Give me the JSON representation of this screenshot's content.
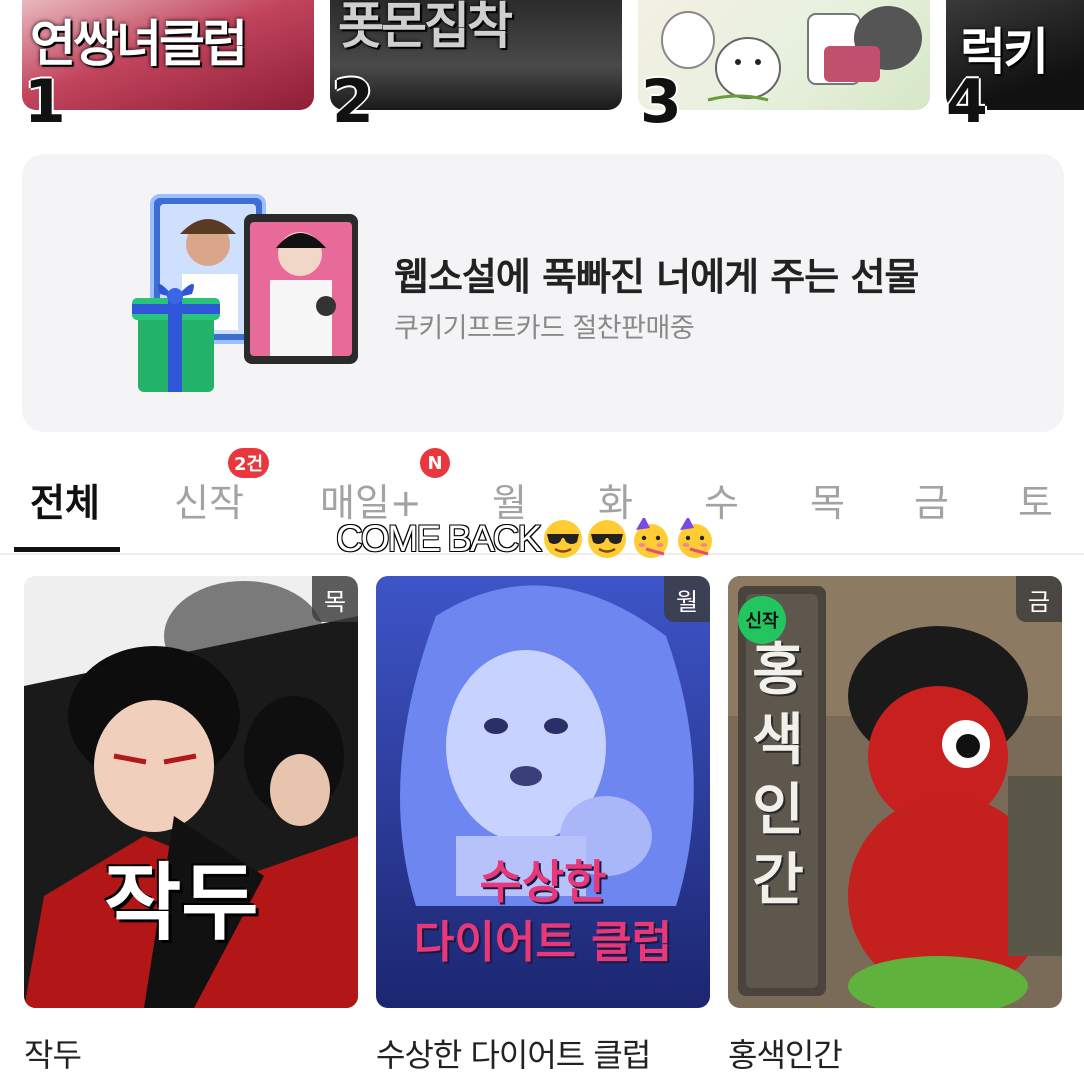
{
  "rankings": [
    {
      "rank": "1",
      "cover_text": "연쌍녀클럽"
    },
    {
      "rank": "2",
      "cover_text": "폿몬집착"
    },
    {
      "rank": "3",
      "cover_text": ""
    },
    {
      "rank": "4",
      "cover_text": "럭키"
    }
  ],
  "promo": {
    "title": "웹소설에 푹빠진 너에게 주는 선물",
    "subtitle": "쿠키기프트카드 절찬판매중",
    "icon": "gift-box-icon"
  },
  "tabs": [
    {
      "label": "전체",
      "active": true
    },
    {
      "label": "신작",
      "badge": "2건"
    },
    {
      "label": "매일+",
      "badge": "N"
    },
    {
      "label": "월"
    },
    {
      "label": "화"
    },
    {
      "label": "수"
    },
    {
      "label": "목"
    },
    {
      "label": "금"
    },
    {
      "label": "토"
    }
  ],
  "overlay": {
    "text": "COME BACK",
    "emojis": [
      "sunglasses-face",
      "sunglasses-face",
      "partying-face",
      "partying-face"
    ]
  },
  "cards": [
    {
      "title": "작두",
      "day": "목",
      "cover_text": "작두",
      "is_new": false
    },
    {
      "title": "수상한 다이어트 클럽",
      "day": "월",
      "cover_text_line1": "수상한",
      "cover_text_line2": "다이어트 클럽",
      "is_new": false
    },
    {
      "title": "홍색인간",
      "day": "금",
      "cover_text": "홍색인간",
      "is_new": true,
      "new_label": "신작"
    }
  ],
  "colors": {
    "badge_red": "#e8383d",
    "new_green": "#22c55e",
    "active_tab": "#111111",
    "inactive_tab": "#a3a3a3"
  }
}
